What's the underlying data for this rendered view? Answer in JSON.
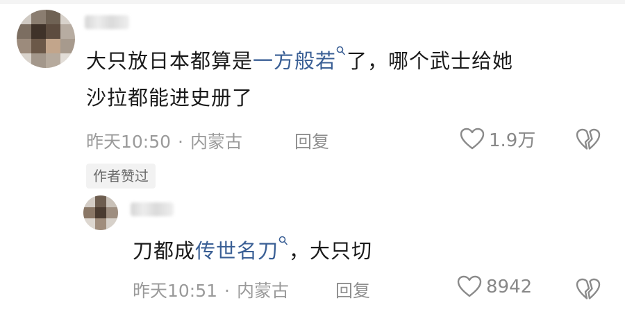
{
  "comments": [
    {
      "text_before": "大只放日本都算是",
      "link_text": "一方般若",
      "text_after_line1": "了，哪个武士给她",
      "text_line2": "沙拉都能进史册了",
      "time": "昨天10:50",
      "location": "内蒙古",
      "reply_label": "回复",
      "likes": "1.9万",
      "author_badge": "作者赞过"
    },
    {
      "text_before": "刀都成",
      "link_text": "传世名刀",
      "text_after": "，大只切",
      "time": "昨天10:51",
      "location": "内蒙古",
      "reply_label": "回复",
      "likes": "8942"
    }
  ],
  "separator": "·",
  "icons": {
    "search": "search-icon",
    "like": "heart-outline-icon",
    "dislike": "broken-heart-icon"
  },
  "colors": {
    "link": "#3a5f95",
    "text": "#1a1a1a",
    "meta": "#9a9a9a",
    "badge_bg": "#f2f2f2"
  }
}
